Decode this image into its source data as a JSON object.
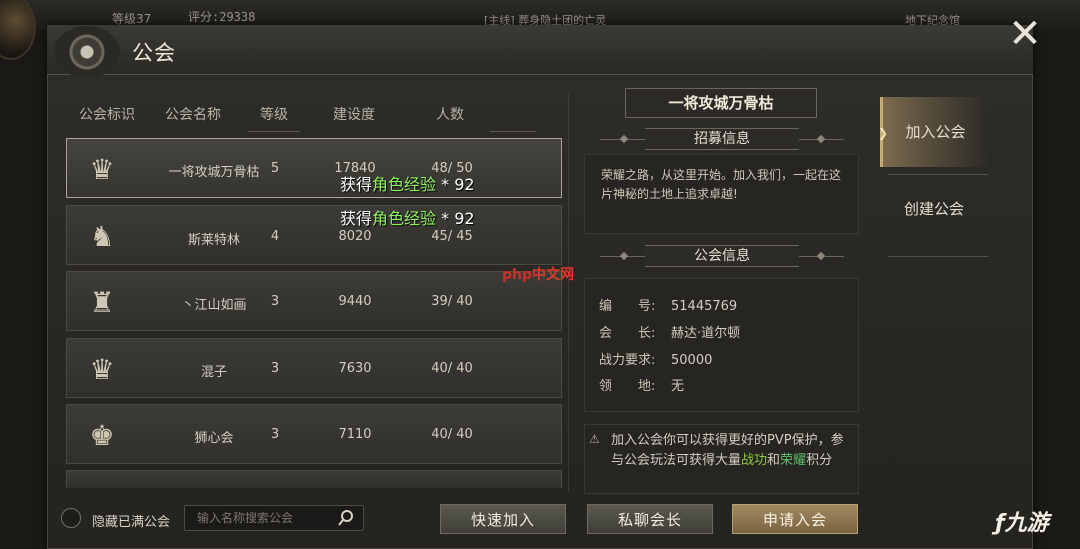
{
  "hud": {
    "level_text": "等级37",
    "score_text": "评分:29338",
    "quest_text": "[主线] 葬身隐土团的亡灵",
    "place_text": "地下纪念馆"
  },
  "window": {
    "title": "公会",
    "close_glyph": "✕"
  },
  "list": {
    "headers": [
      "公会标识",
      "公会名称",
      "等级",
      "建设度",
      "人数"
    ],
    "rows": [
      {
        "name": "一将攻城万骨枯",
        "level": "5",
        "build": "17840",
        "people": "48/ 50",
        "badge": "♛"
      },
      {
        "name": "斯莱特林",
        "level": "4",
        "build": "8020",
        "people": "45/ 45",
        "badge": "♞"
      },
      {
        "name": "丶江山如画",
        "level": "3",
        "build": "9440",
        "people": "39/ 40",
        "badge": "♜"
      },
      {
        "name": "混子",
        "level": "3",
        "build": "7630",
        "people": "40/ 40",
        "badge": "♛"
      },
      {
        "name": "狮心会",
        "level": "3",
        "build": "7110",
        "people": "40/ 40",
        "badge": "♚"
      }
    ]
  },
  "float_msgs": [
    {
      "prefix": "获得",
      "highlight": "角色经验",
      "suffix": " * 92"
    },
    {
      "prefix": "获得",
      "highlight": "角色经验",
      "suffix": " * 92"
    }
  ],
  "watermark": {
    "prefix": "php",
    "suffix": "中文网"
  },
  "bottom": {
    "hide_full_label": "隐藏已满公会",
    "search_placeholder": "输入名称搜索公会",
    "quick_join": "快速加入",
    "chat_leader": "私聊会长",
    "apply_join": "申请入会"
  },
  "detail": {
    "guild_name": "一将攻城万骨枯",
    "recruit_header": "招募信息",
    "recruit_text": "荣耀之路，从这里开始。加入我们，一起在这片神秘的土地上追求卓越!",
    "info_header": "公会信息",
    "info": [
      {
        "key": "编　　号:",
        "value": "51445769"
      },
      {
        "key": "会　　长:",
        "value": "赫达·道尔顿"
      },
      {
        "key": "战力要求:",
        "value": "50000"
      },
      {
        "key": "领　　地:",
        "value": "无"
      }
    ],
    "tip_prefix": "加入公会你可以获得更好的PVP保护，参与公会玩法可获得大量",
    "tip_hl1": "战功",
    "tip_mid": "和",
    "tip_hl2": "荣耀",
    "tip_suffix": "积分",
    "tip_icon": "⚠"
  },
  "side_tabs": [
    {
      "label": "加入公会",
      "active": true
    },
    {
      "label": "创建公会",
      "active": false
    }
  ],
  "logo_text": "ƒ九游"
}
